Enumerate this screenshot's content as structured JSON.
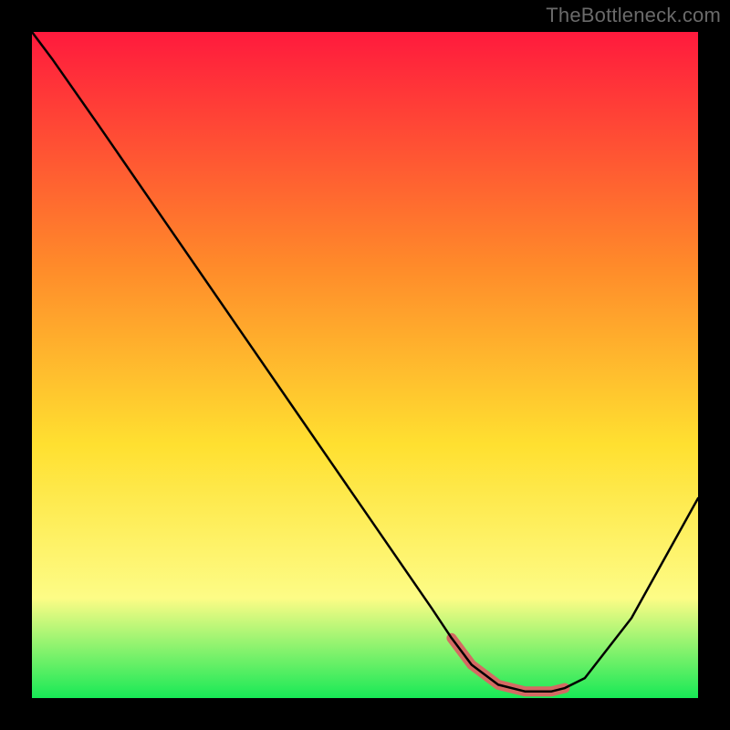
{
  "attribution": "TheBottleneck.com",
  "colors": {
    "frame": "#000000",
    "curve": "#000000",
    "highlight": "#d46a63",
    "gradient_top": "#ff1a3d",
    "gradient_mid_upper": "#ff8a2a",
    "gradient_mid": "#ffe030",
    "gradient_mid_lower": "#fdfc86",
    "gradient_bottom": "#17e956"
  },
  "chart_data": {
    "type": "line",
    "title": "",
    "xlabel": "",
    "ylabel": "",
    "xlim": [
      0,
      100
    ],
    "ylim": [
      0,
      100
    ],
    "x": [
      0,
      3,
      10,
      20,
      30,
      40,
      50,
      60,
      63,
      66,
      70,
      74,
      78,
      80,
      83,
      90,
      100
    ],
    "values": [
      100,
      96,
      86,
      71.5,
      57,
      42.5,
      28,
      13.5,
      9,
      5,
      2,
      1,
      1,
      1.5,
      3,
      12,
      30
    ],
    "highlight_region": {
      "x_start": 63,
      "x_end": 80
    },
    "grid": false,
    "legend": false
  }
}
